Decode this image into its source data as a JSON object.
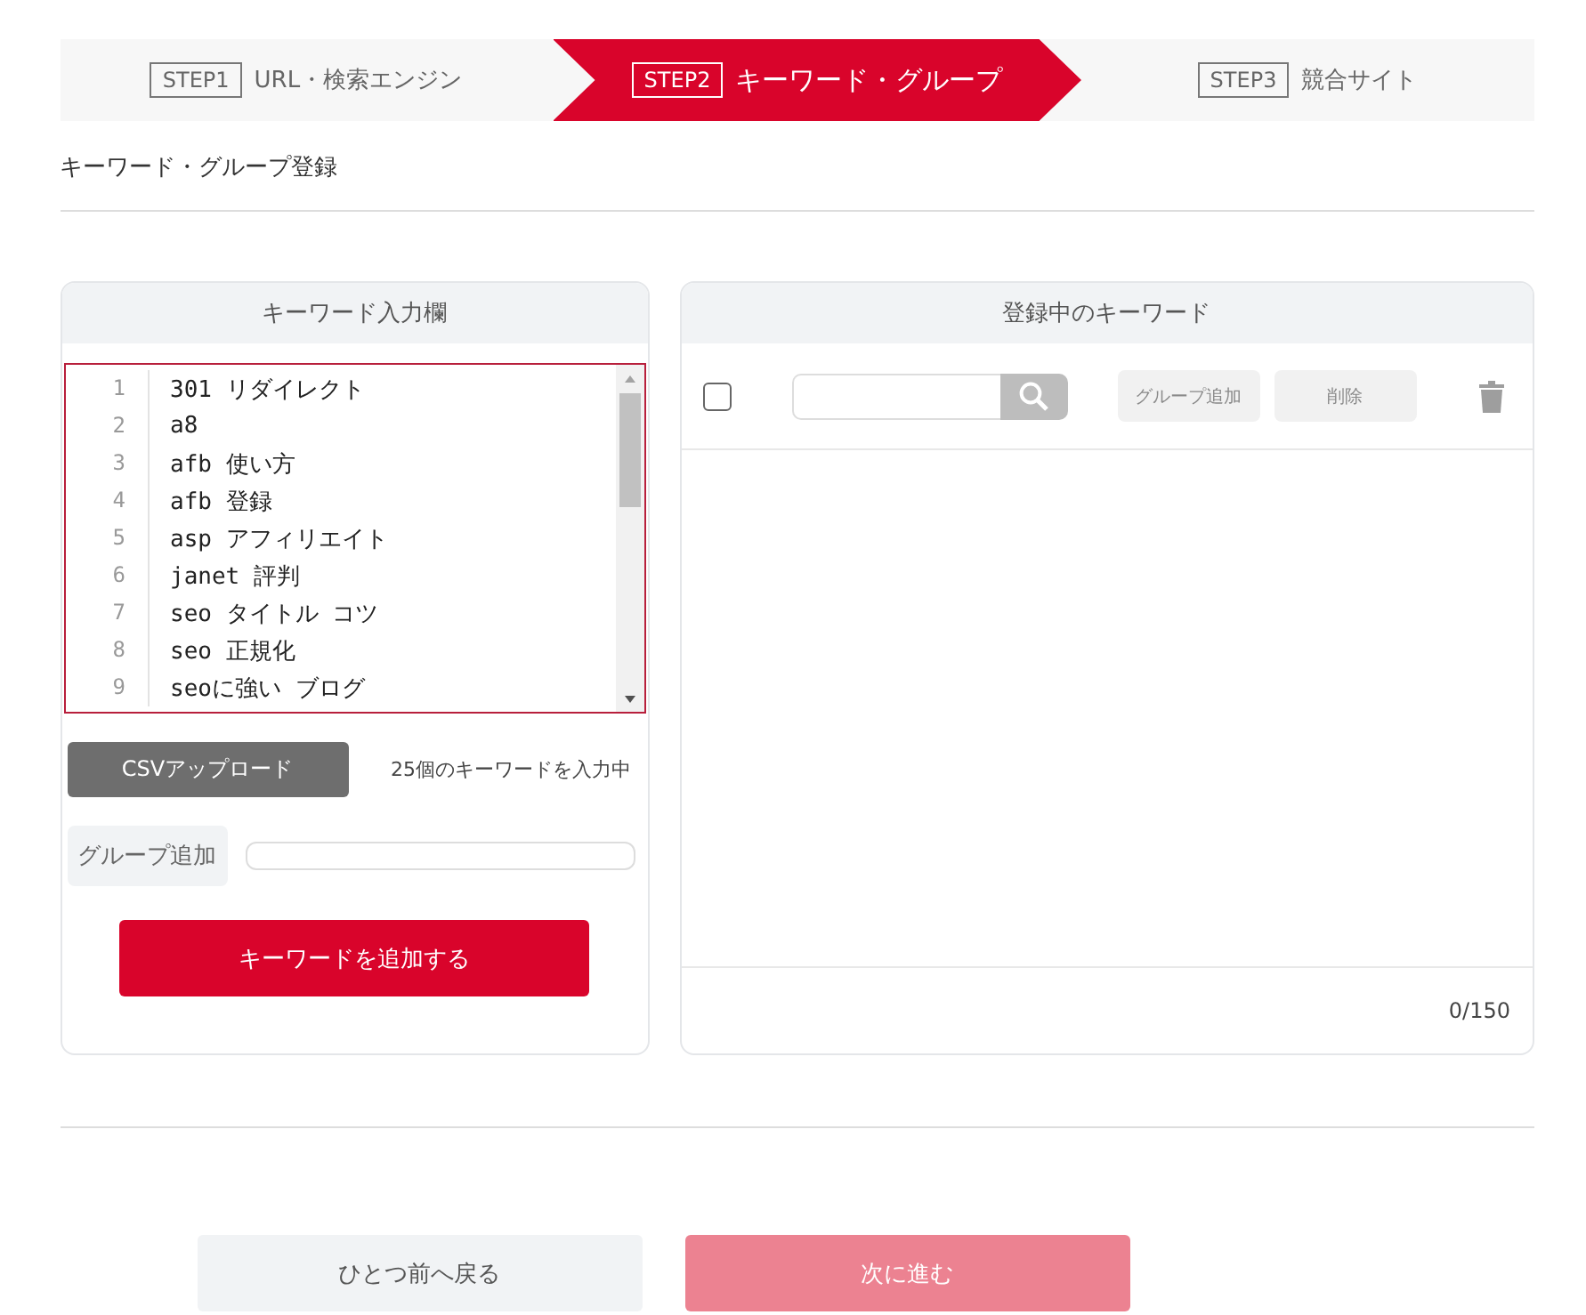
{
  "steps": [
    {
      "tag": "STEP1",
      "label": "URL・検索エンジン",
      "selected": false
    },
    {
      "tag": "STEP2",
      "label": "キーワード・グループ",
      "selected": true
    },
    {
      "tag": "STEP3",
      "label": "競合サイト",
      "selected": false
    }
  ],
  "section_title": "キーワード・グループ登録",
  "input_panel": {
    "title": "キーワード入力欄",
    "lines": [
      {
        "number": "1",
        "text": "301 リダイレクト"
      },
      {
        "number": "2",
        "text": "a8"
      },
      {
        "number": "3",
        "text": "afb 使い方"
      },
      {
        "number": "4",
        "text": "afb 登録"
      },
      {
        "number": "5",
        "text": "asp アフィリエイト"
      },
      {
        "number": "6",
        "text": "janet 評判"
      },
      {
        "number": "7",
        "text": "seo タイトル コツ"
      },
      {
        "number": "8",
        "text": "seo 正規化"
      },
      {
        "number": "9",
        "text": "seoに強い ブログ"
      }
    ],
    "csv_button": "CSVアップロード",
    "count_text": "25個のキーワードを入力中",
    "group_label": "グループ追加",
    "add_button": "キーワードを追加する"
  },
  "registered_panel": {
    "title": "登録中のキーワード",
    "select_all_checked": false,
    "actions": [
      {
        "label": "グループ追加",
        "disabled": true
      },
      {
        "label": "削除",
        "disabled": true
      }
    ],
    "counter": "0/150"
  },
  "nav_buttons": [
    {
      "kind": "back",
      "label": "ひとつ前へ戻る",
      "disabled": false
    },
    {
      "kind": "next",
      "label": "次に進む",
      "disabled": true
    }
  ]
}
